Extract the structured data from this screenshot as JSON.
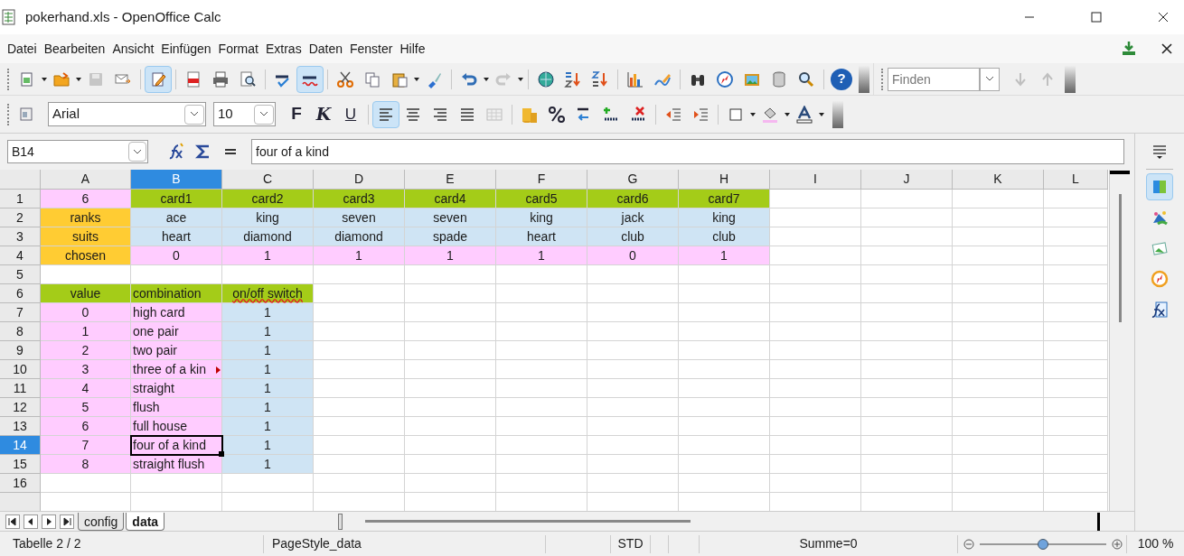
{
  "window": {
    "title": "pokerhand.xls - OpenOffice Calc"
  },
  "menu": [
    "Datei",
    "Bearbeiten",
    "Ansicht",
    "Einfügen",
    "Format",
    "Extras",
    "Daten",
    "Fenster",
    "Hilfe"
  ],
  "standard_toolbar": {
    "help": "?",
    "edit_mode_on": true,
    "auto_spellcheck_on": true,
    "save_disabled": true,
    "redo_disabled": true
  },
  "find_toolbar": {
    "placeholder": "Finden",
    "arrows_disabled": true
  },
  "formatting_toolbar": {
    "font": "Arial",
    "size": "10",
    "bold": "F",
    "italic": "K",
    "underline": "U",
    "align_left_on": true
  },
  "formula_bar": {
    "cell_ref": "B14",
    "content": "four of a kind"
  },
  "sheet": {
    "columns": [
      {
        "label": "A",
        "selected": false
      },
      {
        "label": "B",
        "selected": true
      },
      {
        "label": "C",
        "selected": false
      },
      {
        "label": "D",
        "selected": false
      },
      {
        "label": "E",
        "selected": false
      },
      {
        "label": "F",
        "selected": false
      },
      {
        "label": "G",
        "selected": false
      },
      {
        "label": "H",
        "selected": false
      },
      {
        "label": "I",
        "selected": false
      },
      {
        "label": "J",
        "selected": false
      },
      {
        "label": "K",
        "selected": false
      },
      {
        "label": "L",
        "selected": false
      }
    ],
    "rows": [
      {
        "header": "1",
        "selected": false,
        "cells": [
          {
            "text": "6",
            "color": "#ffccff"
          },
          {
            "text": "card1",
            "color": "#a4cc18"
          },
          {
            "text": "card2",
            "color": "#a4cc18"
          },
          {
            "text": "card3",
            "color": "#a4cc18"
          },
          {
            "text": "card4",
            "color": "#a4cc18"
          },
          {
            "text": "card5",
            "color": "#a4cc18"
          },
          {
            "text": "card6",
            "color": "#a4cc18"
          },
          {
            "text": "card7",
            "color": "#a4cc18"
          }
        ]
      },
      {
        "header": "2",
        "selected": false,
        "cells": [
          {
            "text": "ranks",
            "color": "#ffcc33"
          },
          {
            "text": "ace",
            "color": "#cfe4f4"
          },
          {
            "text": "king",
            "color": "#cfe4f4"
          },
          {
            "text": "seven",
            "color": "#cfe4f4"
          },
          {
            "text": "seven",
            "color": "#cfe4f4"
          },
          {
            "text": "king",
            "color": "#cfe4f4"
          },
          {
            "text": "jack",
            "color": "#cfe4f4"
          },
          {
            "text": "king",
            "color": "#cfe4f4"
          }
        ]
      },
      {
        "header": "3",
        "selected": false,
        "cells": [
          {
            "text": "suits",
            "color": "#ffcc33"
          },
          {
            "text": "heart",
            "color": "#cfe4f4"
          },
          {
            "text": "diamond",
            "color": "#cfe4f4"
          },
          {
            "text": "diamond",
            "color": "#cfe4f4"
          },
          {
            "text": "spade",
            "color": "#cfe4f4"
          },
          {
            "text": "heart",
            "color": "#cfe4f4"
          },
          {
            "text": "club",
            "color": "#cfe4f4"
          },
          {
            "text": "club",
            "color": "#cfe4f4"
          }
        ]
      },
      {
        "header": "4",
        "selected": false,
        "cells": [
          {
            "text": "chosen",
            "color": "#ffcc33"
          },
          {
            "text": "0",
            "color": "#ffccff"
          },
          {
            "text": "1",
            "color": "#ffccff"
          },
          {
            "text": "1",
            "color": "#ffccff"
          },
          {
            "text": "1",
            "color": "#ffccff"
          },
          {
            "text": "1",
            "color": "#ffccff"
          },
          {
            "text": "0",
            "color": "#ffccff"
          },
          {
            "text": "1",
            "color": "#ffccff"
          }
        ]
      },
      {
        "header": "5",
        "selected": false,
        "cells": []
      },
      {
        "header": "6",
        "selected": false,
        "cells": [
          {
            "text": "value",
            "color": "#a4cc18"
          },
          {
            "text": "combination",
            "color": "#a4cc18"
          },
          {
            "text": "on/off switch",
            "color": "#a4cc18",
            "misspelled": true
          }
        ]
      },
      {
        "header": "7",
        "selected": false,
        "cells": [
          {
            "text": "0",
            "color": "#ffccff"
          },
          {
            "text": "high card",
            "color": "#ffccff"
          },
          {
            "text": "1",
            "color": "#cfe4f4"
          }
        ]
      },
      {
        "header": "8",
        "selected": false,
        "cells": [
          {
            "text": "1",
            "color": "#ffccff"
          },
          {
            "text": "one pair",
            "color": "#ffccff"
          },
          {
            "text": "1",
            "color": "#cfe4f4"
          }
        ]
      },
      {
        "header": "9",
        "selected": false,
        "cells": [
          {
            "text": "2",
            "color": "#ffccff"
          },
          {
            "text": "two pair",
            "color": "#ffccff"
          },
          {
            "text": "1",
            "color": "#cfe4f4"
          }
        ]
      },
      {
        "header": "10",
        "selected": false,
        "cells": [
          {
            "text": "3",
            "color": "#ffccff"
          },
          {
            "text": "three of a kin",
            "color": "#ffccff",
            "overflow": true
          },
          {
            "text": "1",
            "color": "#cfe4f4"
          }
        ]
      },
      {
        "header": "11",
        "selected": false,
        "cells": [
          {
            "text": "4",
            "color": "#ffccff"
          },
          {
            "text": "straight",
            "color": "#ffccff"
          },
          {
            "text": "1",
            "color": "#cfe4f4"
          }
        ]
      },
      {
        "header": "12",
        "selected": false,
        "cells": [
          {
            "text": "5",
            "color": "#ffccff"
          },
          {
            "text": "flush",
            "color": "#ffccff"
          },
          {
            "text": "1",
            "color": "#cfe4f4"
          }
        ]
      },
      {
        "header": "13",
        "selected": false,
        "cells": [
          {
            "text": "6",
            "color": "#ffccff"
          },
          {
            "text": "full house",
            "color": "#ffccff"
          },
          {
            "text": "1",
            "color": "#cfe4f4"
          }
        ]
      },
      {
        "header": "14",
        "selected": true,
        "cells": [
          {
            "text": "7",
            "color": "#ffccff"
          },
          {
            "text": "four of a kind",
            "color": "#ffccff",
            "selected": true
          },
          {
            "text": "1",
            "color": "#cfe4f4"
          }
        ]
      },
      {
        "header": "15",
        "selected": false,
        "cells": [
          {
            "text": "8",
            "color": "#ffccff"
          },
          {
            "text": "straight flush",
            "color": "#ffccff"
          },
          {
            "text": "1",
            "color": "#cfe4f4"
          }
        ]
      },
      {
        "header": "16",
        "selected": false,
        "cells": []
      }
    ]
  },
  "sheet_tabs": [
    {
      "label": "config",
      "selected": false
    },
    {
      "label": "data",
      "selected": true
    }
  ],
  "status_bar": {
    "sheet": "Tabelle 2 / 2",
    "page_style": "PageStyle_data",
    "mode": "STD",
    "sum": "Summe=0",
    "zoom": {
      "level": 0.5
    },
    "zoom_percent": "100 %"
  }
}
